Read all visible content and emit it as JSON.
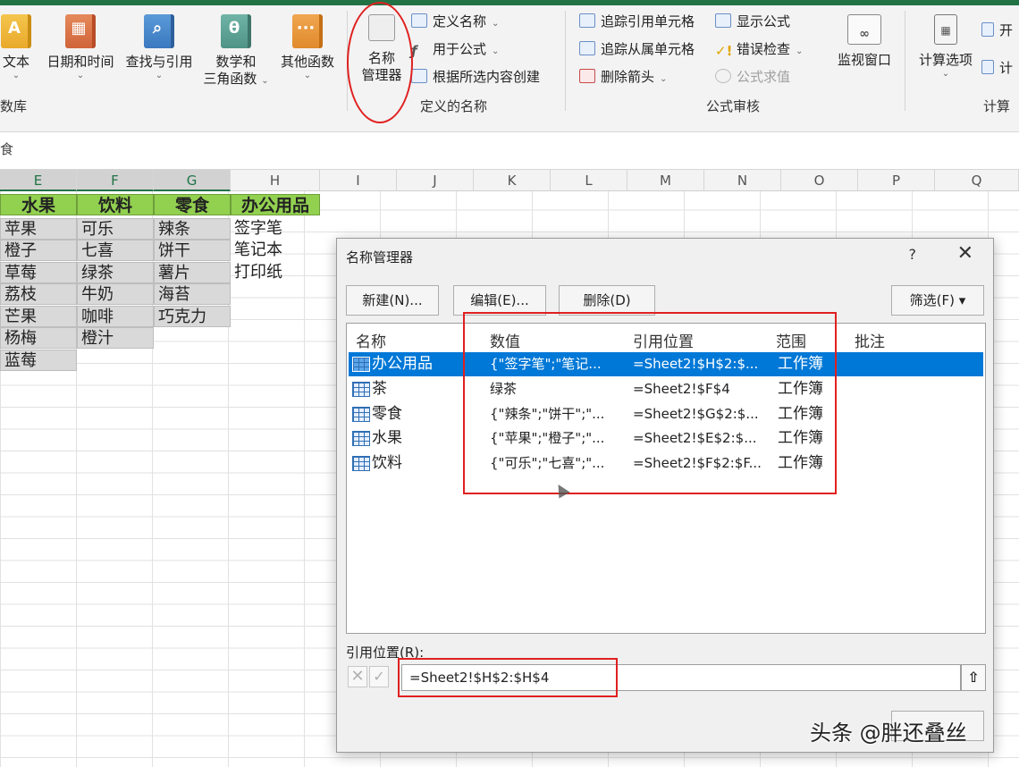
{
  "ribbon": {
    "function_library": {
      "text": "文本",
      "datetime": "日期和时间",
      "lookup": "查找与引用",
      "math_line1": "数学和",
      "math_line2": "三角函数",
      "more": "其他函数",
      "group_label": "数库"
    },
    "defined_names": {
      "name_manager_line1": "名称",
      "name_manager_line2": "管理器",
      "define_name": "定义名称",
      "use_in_formula": "用于公式",
      "create_from_selection": "根据所选内容创建",
      "group_label": "定义的名称"
    },
    "formula_auditing": {
      "trace_precedents": "追踪引用单元格",
      "trace_dependents": "追踪从属单元格",
      "remove_arrows": "删除箭头",
      "show_formulas": "显示公式",
      "error_checking": "错误检查",
      "evaluate_formula": "公式求值",
      "watch_window": "监视窗口",
      "group_label": "公式审核"
    },
    "calculation": {
      "calc_options": "计算选项",
      "start": "开",
      "calc": "计",
      "group_label": "计算"
    }
  },
  "formula_bar": {
    "fragment": "食"
  },
  "columns": [
    "E",
    "F",
    "G",
    "H",
    "I",
    "J",
    "K",
    "L",
    "M",
    "N",
    "O",
    "P",
    "Q"
  ],
  "sheet": {
    "headers": [
      "水果",
      "饮料",
      "零食",
      "办公用品"
    ],
    "fruit": [
      "苹果",
      "橙子",
      "草莓",
      "荔枝",
      "芒果",
      "杨梅",
      "蓝莓"
    ],
    "drinks": [
      "可乐",
      "七喜",
      "绿茶",
      "牛奶",
      "咖啡",
      "橙汁"
    ],
    "snacks": [
      "辣条",
      "饼干",
      "薯片",
      "海苔",
      "巧克力"
    ],
    "office": [
      "签字笔",
      "笔记本",
      "打印纸"
    ]
  },
  "dialog": {
    "title": "名称管理器",
    "help": "?",
    "close": "✕",
    "new_button": "新建(N)...",
    "edit_button": "编辑(E)...",
    "delete_button": "删除(D)",
    "filter_button": "筛选(F) ▾",
    "columns": {
      "name": "名称",
      "value": "数值",
      "refers_to": "引用位置",
      "scope": "范围",
      "comment": "批注"
    },
    "rows": [
      {
        "name": "办公用品",
        "value": "{\"签字笔\";\"笔记...",
        "refers_to": "=Sheet2!$H$2:$...",
        "scope": "工作簿",
        "selected": true
      },
      {
        "name": "茶",
        "value": "绿茶",
        "refers_to": "=Sheet2!$F$4",
        "scope": "工作簿",
        "selected": false
      },
      {
        "name": "零食",
        "value": "{\"辣条\";\"饼干\";\"...",
        "refers_to": "=Sheet2!$G$2:$...",
        "scope": "工作簿",
        "selected": false
      },
      {
        "name": "水果",
        "value": "{\"苹果\";\"橙子\";\"...",
        "refers_to": "=Sheet2!$E$2:$...",
        "scope": "工作簿",
        "selected": false
      },
      {
        "name": "饮料",
        "value": "{\"可乐\";\"七喜\";\"...",
        "refers_to": "=Sheet2!$F$2:$F...",
        "scope": "工作簿",
        "selected": false
      }
    ],
    "refers_to_label": "引用位置(R):",
    "refers_to_value": "=Sheet2!$H$2:$H$4"
  },
  "watermark": "头条 @胖还叠丝",
  "colors": {
    "accent": "#217346",
    "selection": "#0078d7",
    "header_fill": "#92d050",
    "annotation": "#e02020"
  }
}
